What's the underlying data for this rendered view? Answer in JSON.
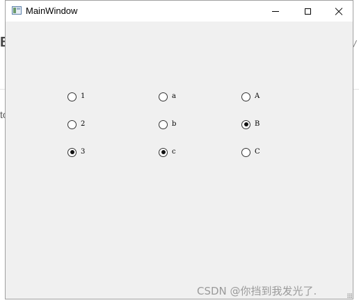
{
  "background_page": {
    "fragment_left_top": "B",
    "fragment_left_mid": "to",
    "fragment_right": "/"
  },
  "window": {
    "title": "MainWindow",
    "controls": {
      "minimize": "minimize",
      "maximize": "maximize",
      "close": "close"
    }
  },
  "radio_groups": [
    {
      "options": [
        {
          "label": "1",
          "checked": false
        },
        {
          "label": "2",
          "checked": false
        },
        {
          "label": "3",
          "checked": true
        }
      ]
    },
    {
      "options": [
        {
          "label": "a",
          "checked": false
        },
        {
          "label": "b",
          "checked": false
        },
        {
          "label": "c",
          "checked": true
        }
      ]
    },
    {
      "options": [
        {
          "label": "A",
          "checked": false
        },
        {
          "label": "B",
          "checked": true
        },
        {
          "label": "C",
          "checked": false
        }
      ]
    }
  ],
  "watermark": "CSDN @你挡到我发光了."
}
